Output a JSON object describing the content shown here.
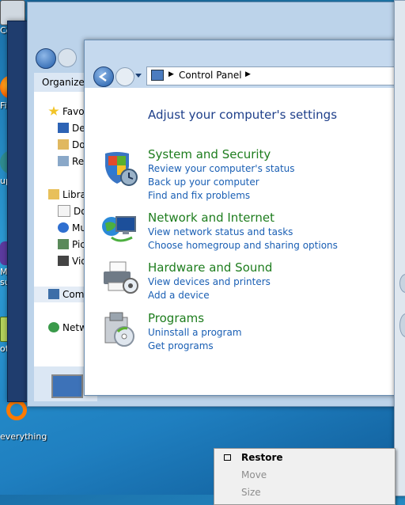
{
  "desktop": {
    "icons": [
      {
        "label": "Compu",
        "icon": "computer-icon"
      },
      {
        "label": "Firefo",
        "icon": "firefox-icon"
      },
      {
        "label": "uperm",
        "icon": "app-icon"
      },
      {
        "label": "Micros\nsual St",
        "icon": "visual-studio-icon"
      },
      {
        "label": "otepa",
        "icon": "notepad-icon"
      },
      {
        "label": "everything",
        "icon": "everything-icon"
      }
    ]
  },
  "explorer_window": {
    "toolbar": {
      "organize_label": "Organize"
    },
    "tree": [
      {
        "label": "Favo",
        "icon": "star-icon"
      },
      {
        "label": "De",
        "icon": "desktop-icon"
      },
      {
        "label": "Do",
        "icon": "downloads-icon"
      },
      {
        "label": "Re",
        "icon": "recent-icon"
      },
      {
        "label": "Libra",
        "icon": "libraries-icon"
      },
      {
        "label": "Do",
        "icon": "documents-icon"
      },
      {
        "label": "Mu",
        "icon": "music-icon"
      },
      {
        "label": "Pic",
        "icon": "pictures-icon"
      },
      {
        "label": "Vid",
        "icon": "videos-icon"
      },
      {
        "label": "Com",
        "icon": "computer-icon"
      },
      {
        "label": "Netw",
        "icon": "network-icon"
      }
    ]
  },
  "control_panel": {
    "address": {
      "item": "Control Panel"
    },
    "heading": "Adjust your computer's settings",
    "categories": [
      {
        "title": "System and Security",
        "icon": "shield-icon",
        "links": [
          "Review your computer's status",
          "Back up your computer",
          "Find and fix problems"
        ]
      },
      {
        "title": "Network and Internet",
        "icon": "network-globe-icon",
        "links": [
          "View network status and tasks",
          "Choose homegroup and sharing options"
        ]
      },
      {
        "title": "Hardware and Sound",
        "icon": "printer-icon",
        "links": [
          "View devices and printers",
          "Add a device"
        ]
      },
      {
        "title": "Programs",
        "icon": "programs-icon",
        "links": [
          "Uninstall a program",
          "Get programs"
        ]
      }
    ]
  },
  "context_menu": {
    "items": [
      {
        "label": "Restore",
        "enabled": true,
        "bold": true
      },
      {
        "label": "Move",
        "enabled": false,
        "bold": false
      },
      {
        "label": "Size",
        "enabled": false,
        "bold": false
      }
    ]
  },
  "colors": {
    "category_title": "#1e7d1e",
    "link": "#1a5fb4",
    "heading": "#1e3f8a"
  }
}
